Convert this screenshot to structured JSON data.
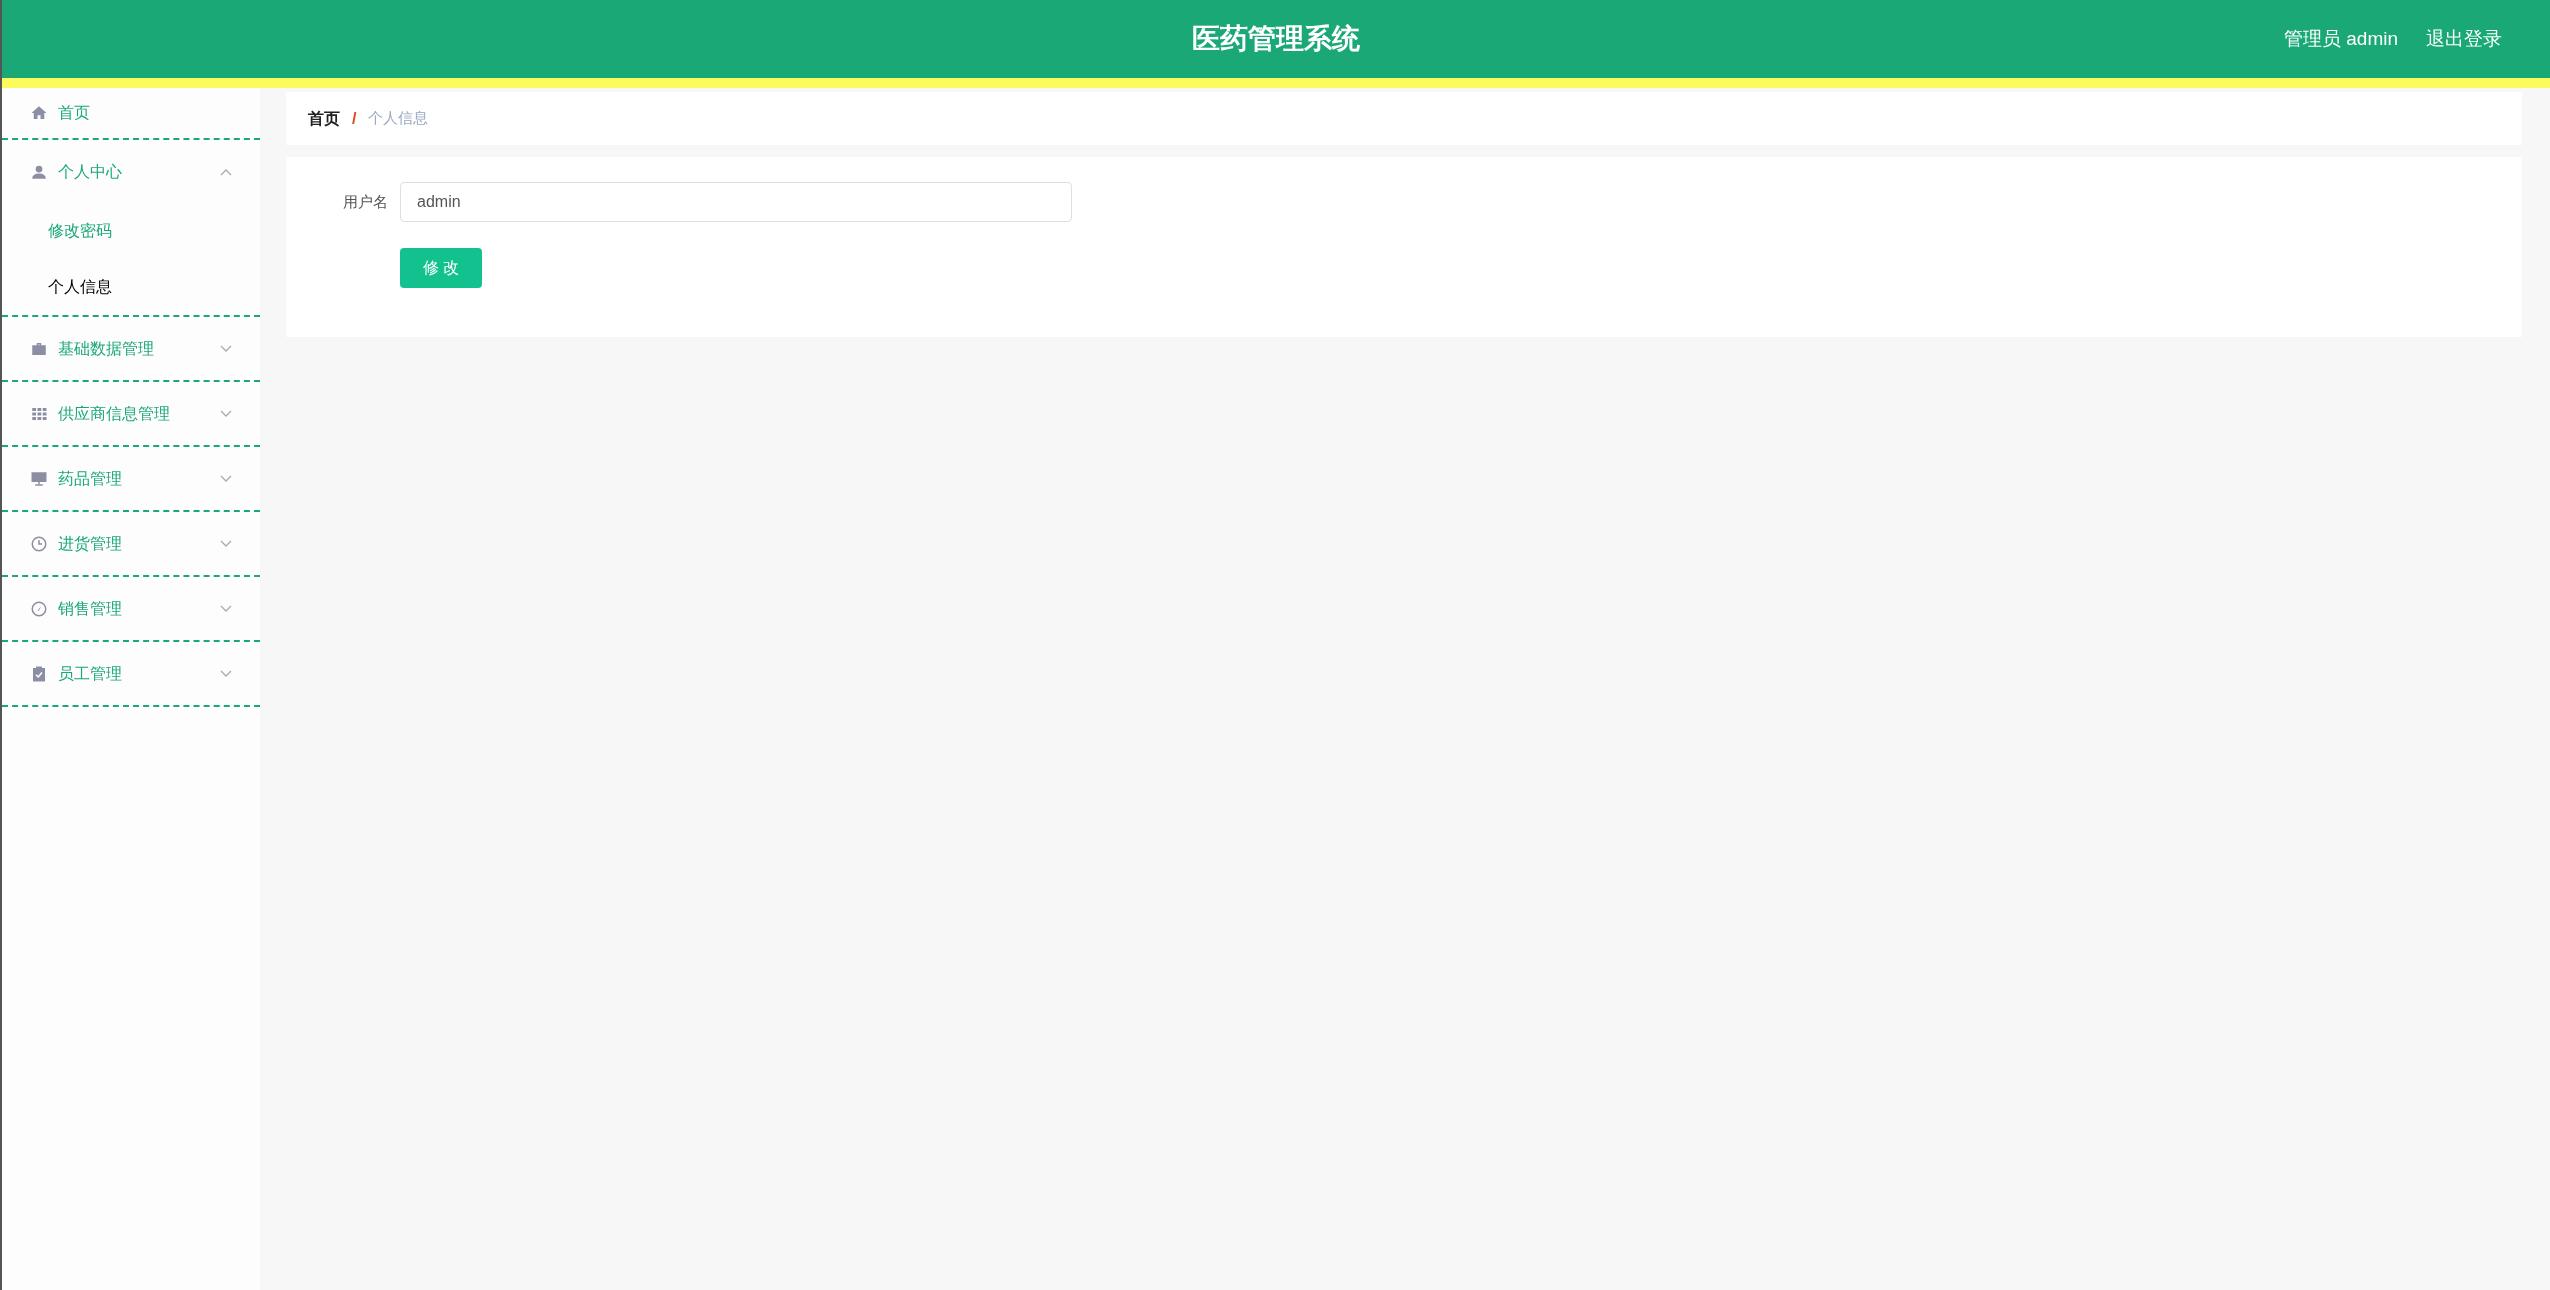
{
  "header": {
    "title": "医药管理系统",
    "user": "管理员 admin",
    "logout": "退出登录"
  },
  "sidebar": {
    "items": [
      {
        "label": "首页",
        "kind": "link"
      },
      {
        "label": "个人中心",
        "kind": "group",
        "expanded": true,
        "children": [
          {
            "label": "修改密码",
            "selected": false
          },
          {
            "label": "个人信息",
            "selected": true
          }
        ]
      },
      {
        "label": "基础数据管理",
        "kind": "group",
        "expanded": false
      },
      {
        "label": "供应商信息管理",
        "kind": "group",
        "expanded": false
      },
      {
        "label": "药品管理",
        "kind": "group",
        "expanded": false
      },
      {
        "label": "进货管理",
        "kind": "group",
        "expanded": false
      },
      {
        "label": "销售管理",
        "kind": "group",
        "expanded": false
      },
      {
        "label": "员工管理",
        "kind": "group",
        "expanded": false
      }
    ]
  },
  "breadcrumb": {
    "separator": "/",
    "items": [
      "首页",
      "个人信息"
    ]
  },
  "form": {
    "fields": [
      {
        "label": "用户名",
        "value": "admin"
      }
    ],
    "submit": "修 改"
  }
}
